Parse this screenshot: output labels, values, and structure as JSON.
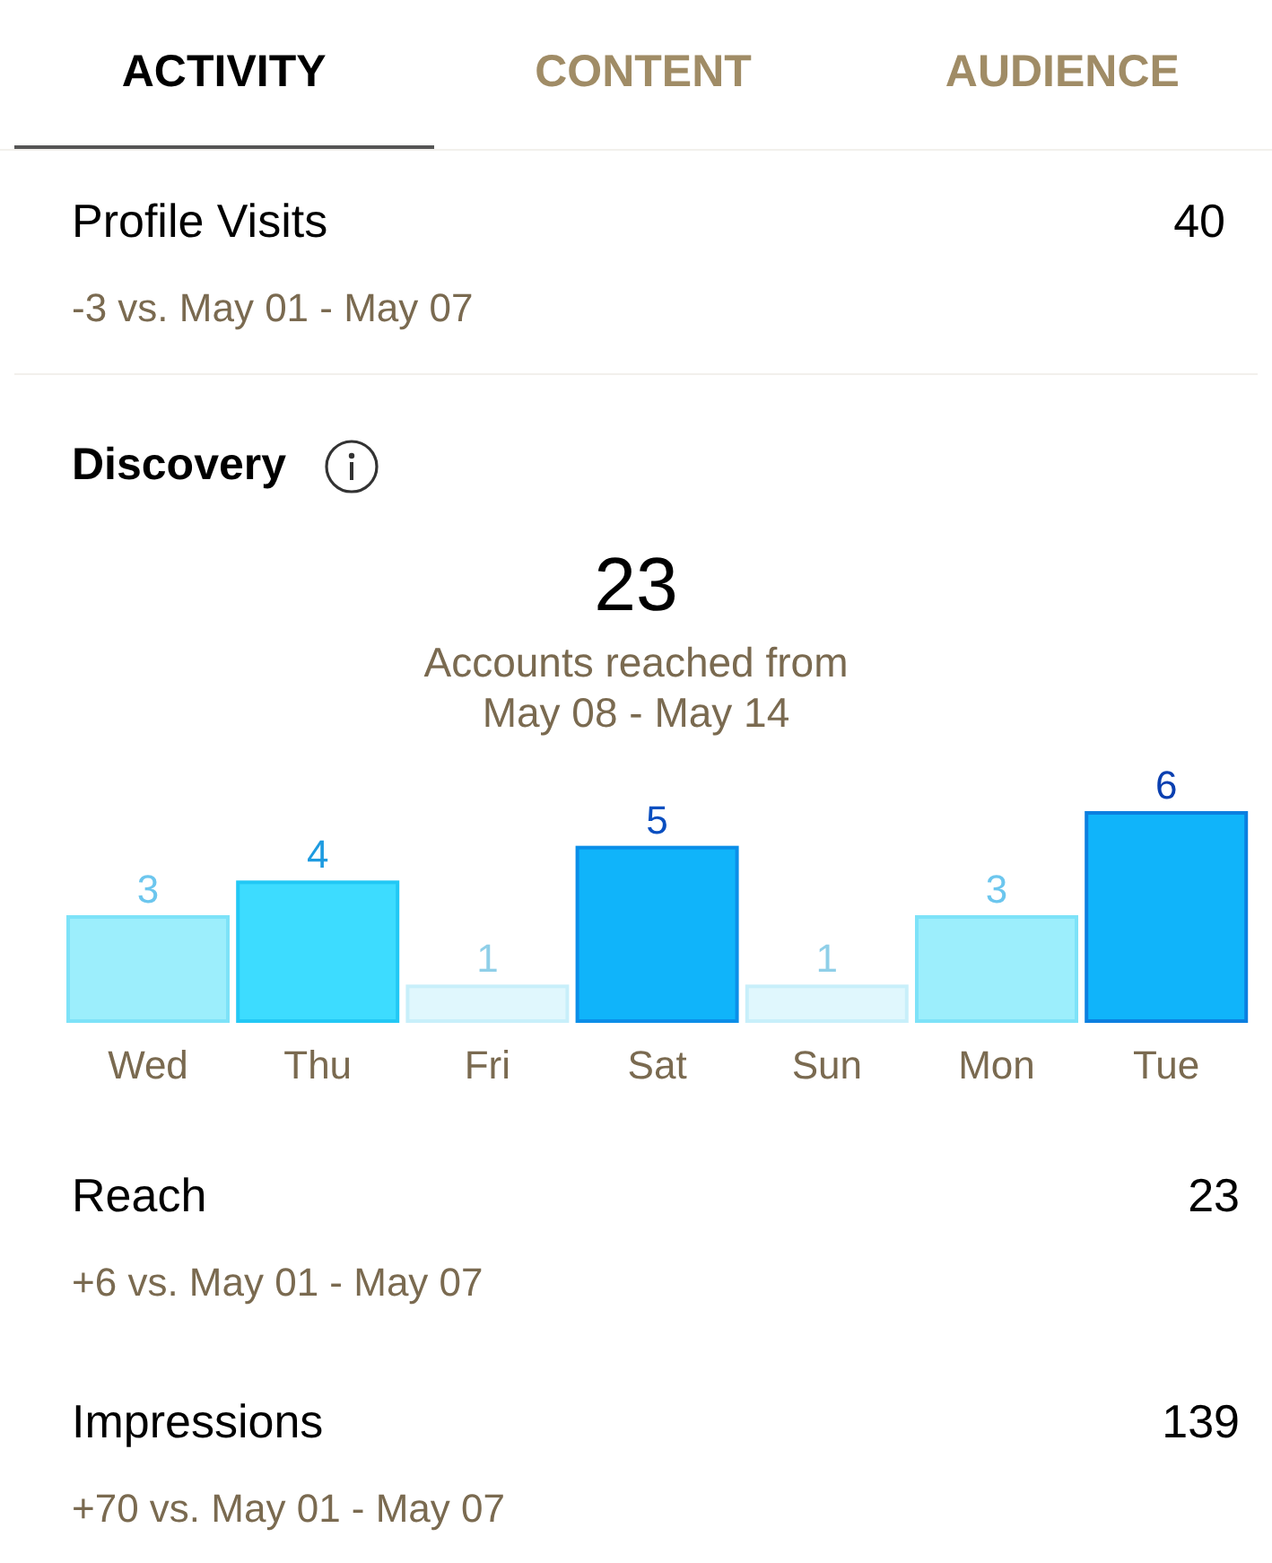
{
  "tabs": [
    {
      "label": "ACTIVITY",
      "selected": true
    },
    {
      "label": "CONTENT",
      "selected": false
    },
    {
      "label": "AUDIENCE",
      "selected": false
    }
  ],
  "profile_visits": {
    "label": "Profile Visits",
    "value": "40",
    "comparison": "-3 vs. May 01 - May 07"
  },
  "discovery": {
    "title": "Discovery",
    "total": "23",
    "caption_line_1": "Accounts reached from",
    "caption_line_2": "May 08 - May 14",
    "chart_data": {
      "type": "bar",
      "categories": [
        "Wed",
        "Thu",
        "Fri",
        "Sat",
        "Sun",
        "Mon",
        "Tue"
      ],
      "values": [
        3,
        4,
        1,
        5,
        1,
        3,
        6
      ],
      "data_labels": true
    }
  },
  "metrics": [
    {
      "label": "Reach",
      "value": "23",
      "comparison": "+6 vs. May 01 - May 07"
    },
    {
      "label": "Impressions",
      "value": "139",
      "comparison": "+70 vs. May 01 - May 07"
    }
  ]
}
